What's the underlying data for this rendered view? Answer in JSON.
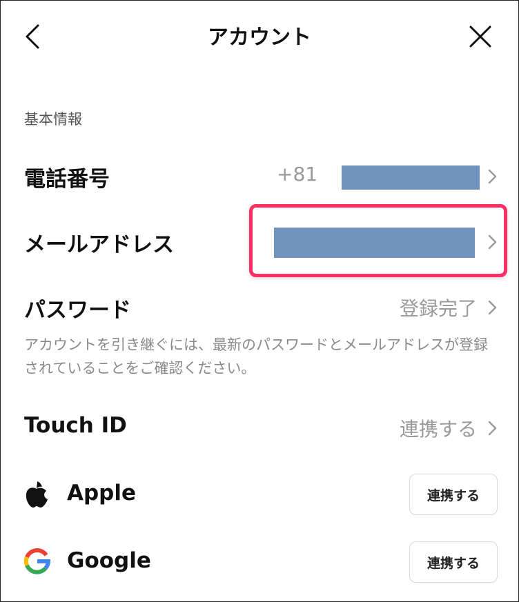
{
  "header": {
    "title": "アカウント"
  },
  "section": {
    "label": "基本情報"
  },
  "rows": {
    "phone": {
      "label": "電話番号",
      "prefix": "+81"
    },
    "email": {
      "label": "メールアドレス"
    },
    "password": {
      "label": "パスワード",
      "value": "登録完了"
    },
    "touch_id": {
      "label": "Touch ID",
      "value": "連携する"
    }
  },
  "description": "アカウントを引き継ぐには、最新のパスワードとメールアドレスが登録されていることをご確認ください。",
  "providers": {
    "apple": {
      "label": "Apple",
      "button": "連携する"
    },
    "google": {
      "label": "Google",
      "button": "連携する"
    }
  },
  "colors": {
    "highlight": "#ff2e63",
    "redaction": "#6f93bd"
  },
  "icons": [
    "back-arrow-icon",
    "close-icon",
    "chevron-right-icon",
    "apple-logo-icon",
    "google-logo-icon"
  ]
}
